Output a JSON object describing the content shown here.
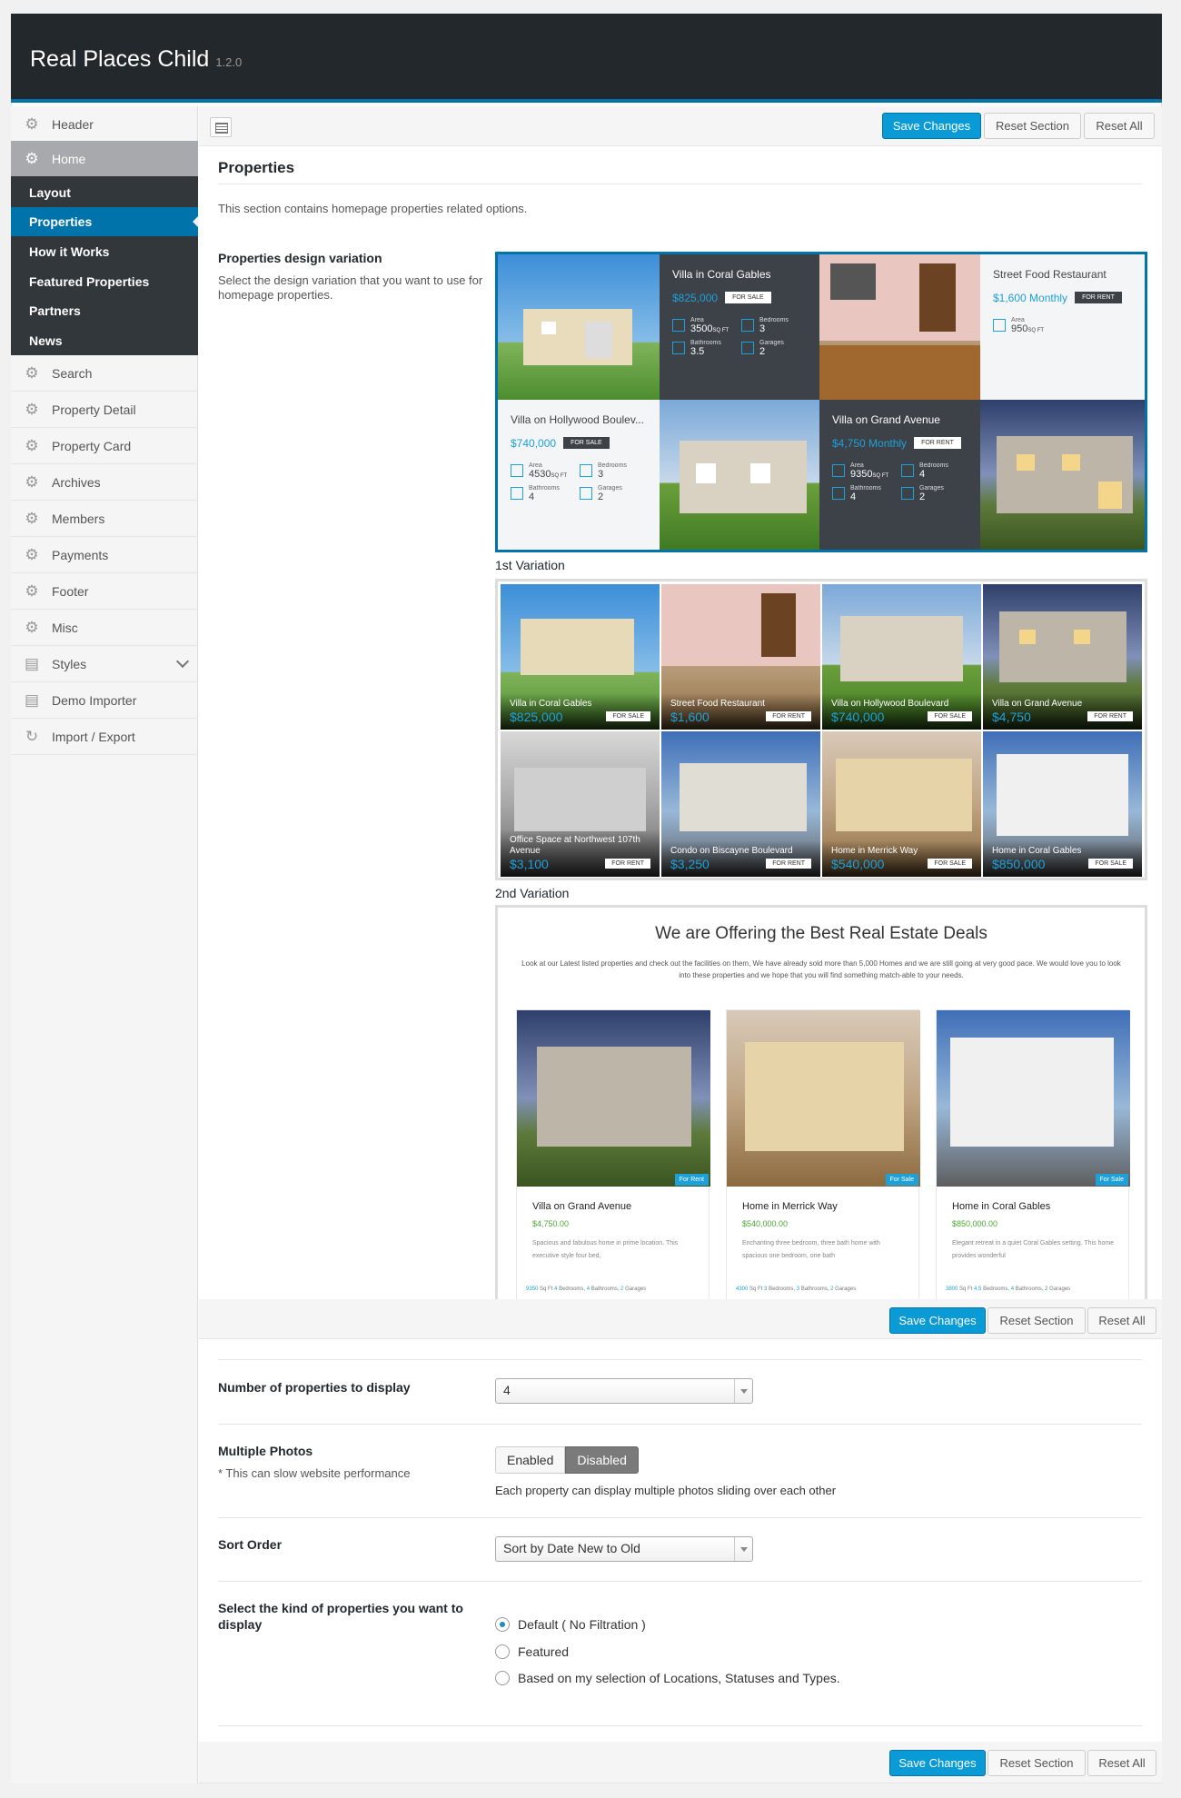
{
  "app": {
    "title": "Real Places Child",
    "version": "1.2.0"
  },
  "sidebar": {
    "items": [
      {
        "label": "Header",
        "icon": "gear-icon"
      },
      {
        "label": "Home",
        "icon": "gear-icon"
      },
      {
        "label": "Search",
        "icon": "gear-icon"
      },
      {
        "label": "Property Detail",
        "icon": "gear-icon"
      },
      {
        "label": "Property Card",
        "icon": "gear-icon"
      },
      {
        "label": "Archives",
        "icon": "gear-icon"
      },
      {
        "label": "Members",
        "icon": "gear-icon"
      },
      {
        "label": "Payments",
        "icon": "gear-icon"
      },
      {
        "label": "Footer",
        "icon": "gear-icon"
      },
      {
        "label": "Misc",
        "icon": "gear-icon"
      },
      {
        "label": "Styles",
        "icon": "layout-icon"
      },
      {
        "label": "Demo Importer",
        "icon": "layout-icon"
      },
      {
        "label": "Import / Export",
        "icon": "refresh-icon"
      }
    ],
    "submenu": [
      "Layout",
      "Properties",
      "How it Works",
      "Featured Properties",
      "Partners",
      "News"
    ]
  },
  "toolbar": {
    "save": "Save Changes",
    "reset_section": "Reset Section",
    "reset_all": "Reset All"
  },
  "section": {
    "title": "Properties",
    "description": "This section contains homepage properties related options."
  },
  "design_variation": {
    "label": "Properties design variation",
    "description": "Select the design variation that you want to use for homepage properties.",
    "var1_label": "1st Variation",
    "var2_label": "2nd Variation",
    "var1": {
      "cards": [
        {
          "title": "Villa in Coral Gables",
          "price": "$825,000",
          "tag": "FOR SALE",
          "area": "3500",
          "bedrooms": "3",
          "bathrooms": "3.5",
          "garages": "2"
        },
        {
          "title": "Street Food Restaurant",
          "price": "$1,600 Monthly",
          "tag": "FOR RENT",
          "area": "950"
        },
        {
          "title": "Villa on Hollywood Boulev...",
          "price": "$740,000",
          "tag": "FOR SALE",
          "area": "4530",
          "bedrooms": "3",
          "bathrooms": "4",
          "garages": "2"
        },
        {
          "title": "Villa on Grand Avenue",
          "price": "$4,750 Monthly",
          "tag": "FOR RENT",
          "area": "9350",
          "bedrooms": "4",
          "bathrooms": "4",
          "garages": "2"
        }
      ],
      "labels": {
        "area": "Area",
        "bedrooms": "Bedrooms",
        "bathrooms": "Bathrooms",
        "garages": "Garages",
        "sqft": "SQ FT"
      }
    },
    "var2": {
      "tiles": [
        {
          "title": "Villa in Coral Gables",
          "price": "$825,000",
          "tag": "FOR SALE"
        },
        {
          "title": "Street Food Restaurant",
          "price": "$1,600",
          "tag": "FOR RENT"
        },
        {
          "title": "Villa on Hollywood Boulevard",
          "price": "$740,000",
          "tag": "FOR SALE"
        },
        {
          "title": "Villa on Grand Avenue",
          "price": "$4,750",
          "tag": "FOR RENT"
        },
        {
          "title": "Office Space at Northwest 107th Avenue",
          "price": "$3,100",
          "tag": "FOR RENT"
        },
        {
          "title": "Condo on Biscayne Boulevard",
          "price": "$3,250",
          "tag": "FOR RENT"
        },
        {
          "title": "Home in Merrick Way",
          "price": "$540,000",
          "tag": "FOR SALE"
        },
        {
          "title": "Home in Coral Gables",
          "price": "$850,000",
          "tag": "FOR SALE"
        }
      ]
    },
    "var3": {
      "title": "We are Offering the Best Real Estate Deals",
      "description": "Look at our Latest listed properties and check out the facilities on them, We have already sold more than 5,000 Homes and we are still going at very good pace. We would love you to look into these properties and we hope that you will find something match-able to your needs.",
      "cards": [
        {
          "name": "Villa on Grand Avenue",
          "price": "$4,750.00",
          "badge": "For Rent",
          "text": "Spacious and fabulous home in prime location. This executive style four bed,",
          "meta": [
            "9350",
            "Sq Ft",
            "4",
            "Bedrooms,",
            "4",
            "Bathrooms,",
            "2",
            "Garages"
          ]
        },
        {
          "name": "Home in Merrick Way",
          "price": "$540,000.00",
          "badge": "For Sale",
          "text": "Enchanting three bedroom, three bath home with spacious one bedroom, one bath",
          "meta": [
            "4300",
            "Sq Ft",
            "3",
            "Bedrooms,",
            "3",
            "Bathrooms,",
            "2",
            "Garages"
          ]
        },
        {
          "name": "Home in Coral Gables",
          "price": "$850,000.00",
          "badge": "For Sale",
          "text": "Elegant retreat in a quiet Coral Gables setting. This home provides wonderful",
          "meta": [
            "3800",
            "Sq Ft",
            "4.5",
            "Bedrooms,",
            "4",
            "Bathrooms,",
            "2",
            "Garages"
          ]
        }
      ]
    }
  },
  "num_properties": {
    "label": "Number of properties to display",
    "value": "4"
  },
  "multiple_photos": {
    "label": "Multiple Photos",
    "note": "* This can slow website performance",
    "enabled": "Enabled",
    "disabled": "Disabled",
    "selected": "Disabled",
    "help": "Each property can display multiple photos sliding over each other"
  },
  "sort_order": {
    "label": "Sort Order",
    "value": "Sort by Date New to Old"
  },
  "kind": {
    "label": "Select the kind of properties you want to display",
    "options": [
      "Default ( No Filtration )",
      "Featured",
      "Based on my selection of Locations, Statuses and Types."
    ],
    "selected": 0
  },
  "colors": {
    "primary": "#0a9bd6",
    "header_bg": "#23282d",
    "accent": "#1ea0d8",
    "price_green": "#4aa933"
  }
}
